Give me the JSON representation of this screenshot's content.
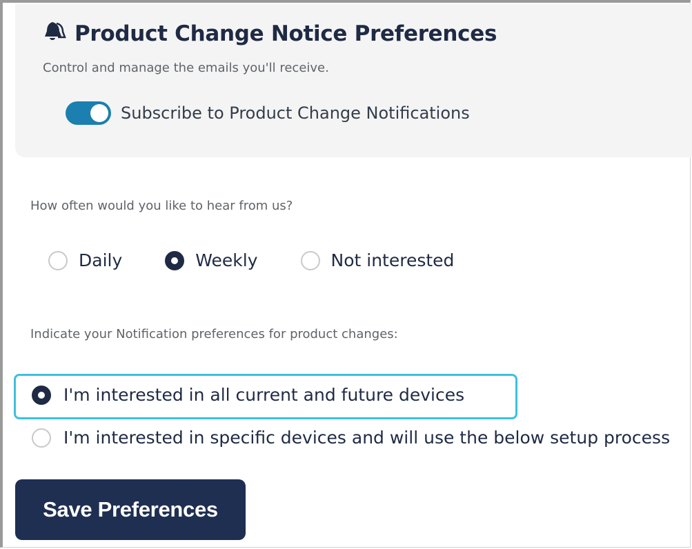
{
  "header": {
    "title": "Product Change Notice Preferences",
    "subtitle": "Control and manage the emails you'll receive.",
    "title_icon": "bell-icon",
    "subscribe": {
      "label": "Subscribe to Product Change Notifications",
      "enabled": true
    }
  },
  "frequency": {
    "question": "How often would you like to hear from us?",
    "options": [
      {
        "label": "Daily",
        "selected": false
      },
      {
        "label": "Weekly",
        "selected": true
      },
      {
        "label": "Not interested",
        "selected": false
      }
    ]
  },
  "notification_prefs": {
    "question": "Indicate your Notification preferences for product changes:",
    "options": [
      {
        "label": "I'm interested in all current and future devices",
        "selected": true,
        "focused": true
      },
      {
        "label": "I'm interested in specific devices and will use the below setup process",
        "selected": false
      }
    ]
  },
  "actions": {
    "save_label": "Save Preferences"
  },
  "colors": {
    "accent": "#1b7fb0",
    "primary_dark": "#1e2f52",
    "focus": "#3cc0e0",
    "panel_bg": "#f4f4f4"
  }
}
